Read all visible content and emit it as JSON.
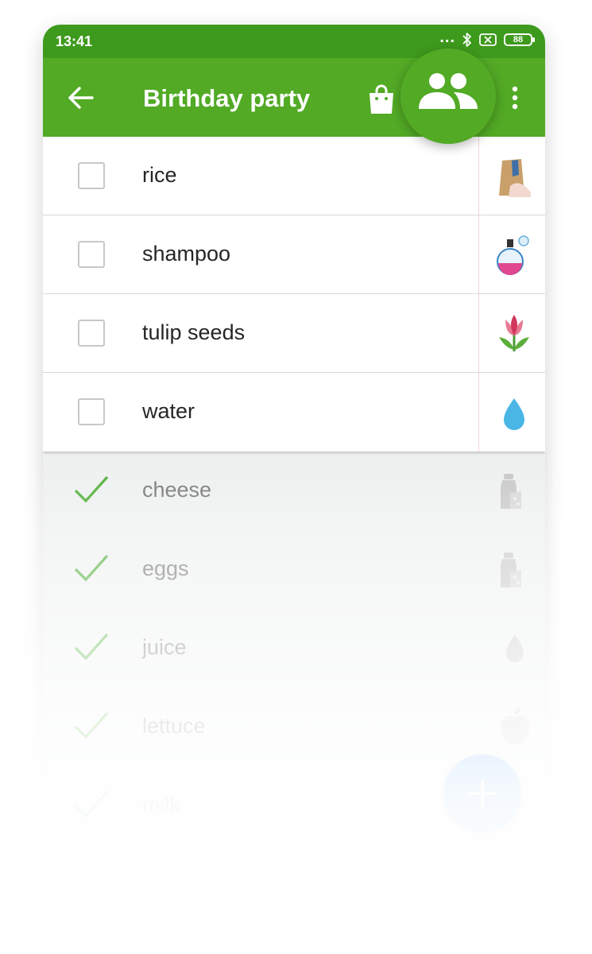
{
  "status_bar": {
    "time": "13:41",
    "signal_dots": "...",
    "battery": "88",
    "icons": [
      "bluetooth-icon",
      "sim-off-icon",
      "battery-icon"
    ]
  },
  "app_bar": {
    "title": "Birthday party",
    "back_icon": "arrow-left-icon",
    "actions": [
      "shopping-bag-icon",
      "share-people-icon",
      "more-vertical-icon"
    ],
    "color": "#52aa25",
    "status_color": "#3e9a1d"
  },
  "active_items": [
    {
      "label": "rice",
      "icon": "rice-bag-icon"
    },
    {
      "label": "shampoo",
      "icon": "perfume-bottle-icon"
    },
    {
      "label": "tulip seeds",
      "icon": "tulip-icon"
    },
    {
      "label": "water",
      "icon": "water-drop-icon"
    }
  ],
  "checked_items": [
    {
      "label": "cheese",
      "icon": "dairy-icon"
    },
    {
      "label": "eggs",
      "icon": "dairy-icon"
    },
    {
      "label": "juice",
      "icon": "drop-icon"
    },
    {
      "label": "lettuce",
      "icon": "apple-icon"
    },
    {
      "label": "milk",
      "icon": "dairy-icon"
    },
    {
      "label": "",
      "icon": ""
    }
  ],
  "fab": {
    "icon": "plus-icon",
    "color": "#2f8ef0"
  },
  "check_color": "#4caf32"
}
